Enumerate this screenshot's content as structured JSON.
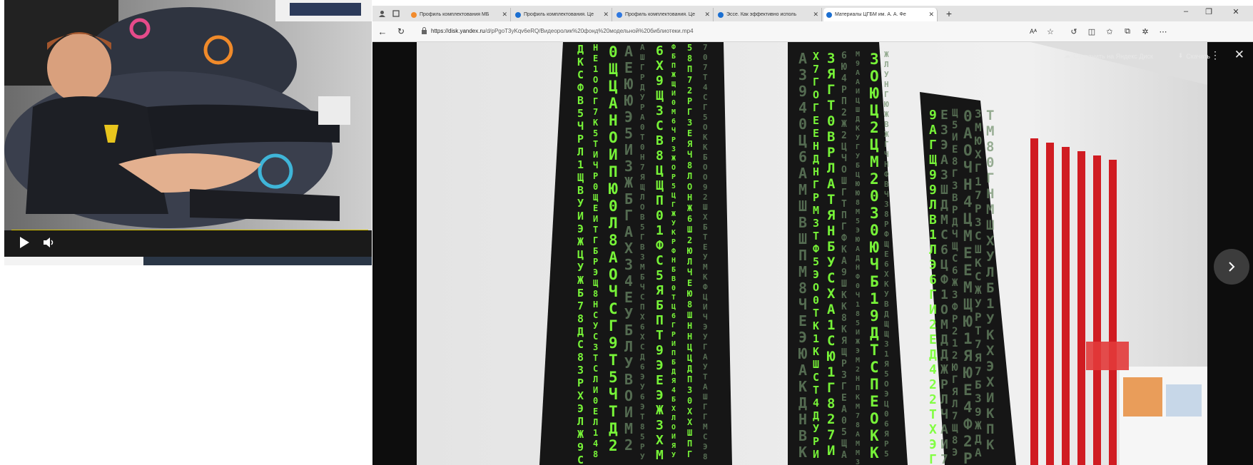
{
  "left_player": {
    "play_icon": "play-icon",
    "volume_icon": "volume-icon"
  },
  "browser": {
    "tabs": [
      {
        "label": "Профиль комплектования МБ",
        "favicon_color": "#f28b2c"
      },
      {
        "label": "Профиль комплектования. Це",
        "favicon_color": "#1b6fd1"
      },
      {
        "label": "Профиль комплектования. Це",
        "favicon_color": "#2f78e0"
      },
      {
        "label": "Эссе. Как эффективно исполь",
        "favicon_color": "#1b6fd1"
      },
      {
        "label": "Материалы ЦГБМ им. А. А. Фе",
        "favicon_color": "#1b6fd1"
      }
    ],
    "new_tab_label": "+",
    "url_host": "https://disk.yandex.ru",
    "url_path": "/d/pPgoT3yKqv6eRQ/Видеоролик%20фонд%20модельной%20библиотеки.mp4",
    "viewer": {
      "save_label": "Сохранить на Яндекс Диск",
      "download_label": "Скачать"
    }
  },
  "colors": {
    "matrix_green": "#7dff3a",
    "panel_black": "#161616",
    "stripe_red": "#d01c22"
  }
}
